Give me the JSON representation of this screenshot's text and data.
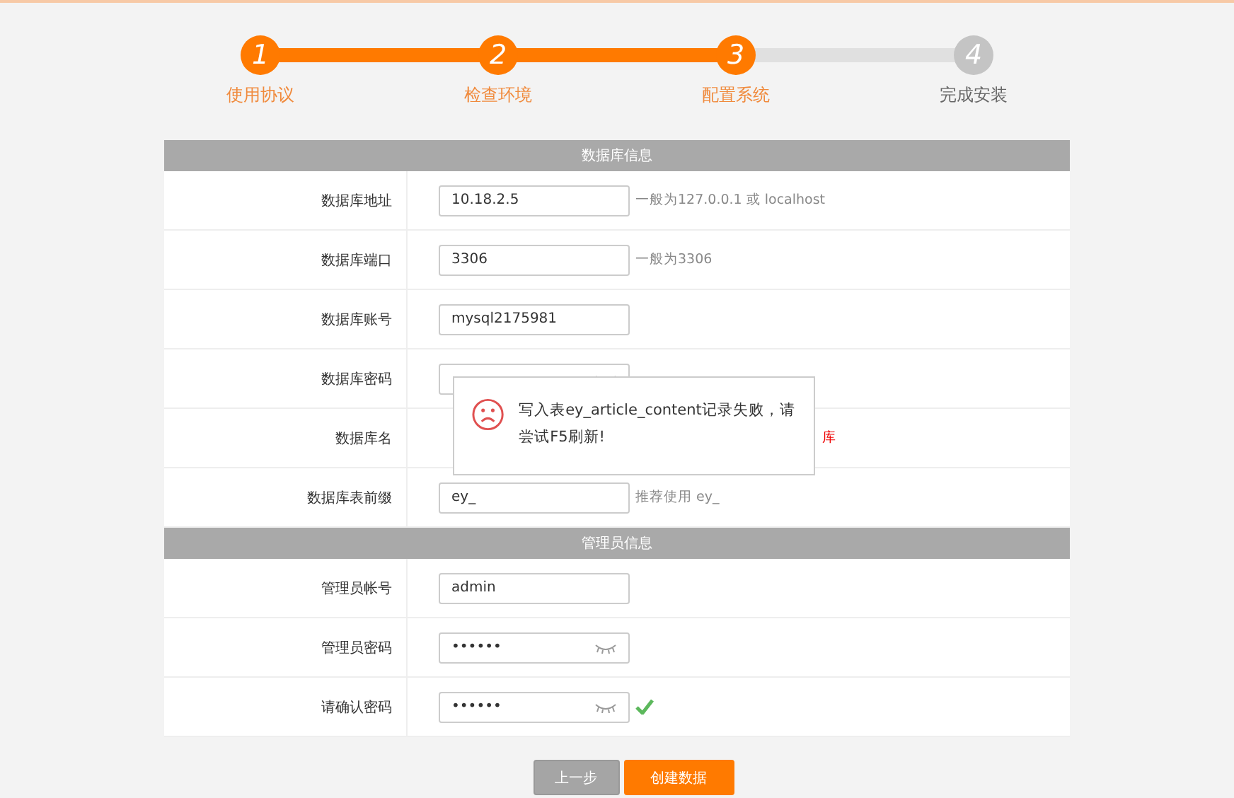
{
  "steps": [
    {
      "number": "1",
      "label": "使用协议",
      "done": true
    },
    {
      "number": "2",
      "label": "检查环境",
      "done": true
    },
    {
      "number": "3",
      "label": "配置系统",
      "done": true
    },
    {
      "number": "4",
      "label": "完成安装",
      "done": false
    }
  ],
  "sections": [
    {
      "title": "数据库信息",
      "rows": [
        {
          "label": "数据库地址",
          "kind": "text",
          "value": "10.18.2.5",
          "hint": "一般为127.0.0.1 或 localhost",
          "hint_error": false
        },
        {
          "label": "数据库端口",
          "kind": "text",
          "value": "3306",
          "hint": "一般为3306",
          "hint_error": false
        },
        {
          "label": "数据库账号",
          "kind": "text",
          "value": "mysql2175981"
        },
        {
          "label": "数据库密码",
          "kind": "password"
        },
        {
          "label": "数据库名",
          "kind": "hidden",
          "hint": "库",
          "hint_error": true
        },
        {
          "label": "数据库表前缀",
          "kind": "text",
          "value": "ey_",
          "hint": "推荐使用 ey_",
          "hint_error": false
        }
      ]
    },
    {
      "title": "管理员信息",
      "rows": [
        {
          "label": "管理员帐号",
          "kind": "text",
          "value": "admin"
        },
        {
          "label": "管理员密码",
          "kind": "password",
          "value": "••••••"
        },
        {
          "label": "请确认密码",
          "kind": "password",
          "value": "••••••",
          "valid": true
        }
      ]
    }
  ],
  "buttons": [
    {
      "label": "上一步",
      "primary": false
    },
    {
      "label": "创建数据",
      "primary": true
    }
  ],
  "dialog": {
    "message": "写入表ey_article_content记录失败，请尝试F5刷新!"
  }
}
